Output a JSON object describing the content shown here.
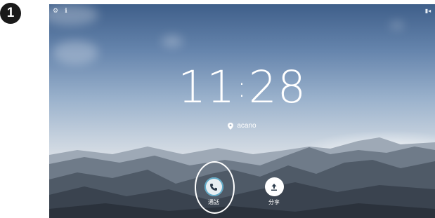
{
  "step_number": "1",
  "status_bar": {
    "left_icons": [
      "settings-icon",
      "info-icon"
    ],
    "right_icon": "camera-icon"
  },
  "clock": {
    "hours": "11",
    "separator": ":",
    "minutes": "28"
  },
  "location": {
    "icon": "location-pin-icon",
    "name": "acano"
  },
  "actions": [
    {
      "label": "通話",
      "icon": "phone-icon",
      "highlighted": true
    },
    {
      "label": "分享",
      "icon": "upload-icon",
      "highlighted": false
    }
  ],
  "colors": {
    "call_accent": "#5fa8c5",
    "highlight_ring": "#ffffff"
  }
}
